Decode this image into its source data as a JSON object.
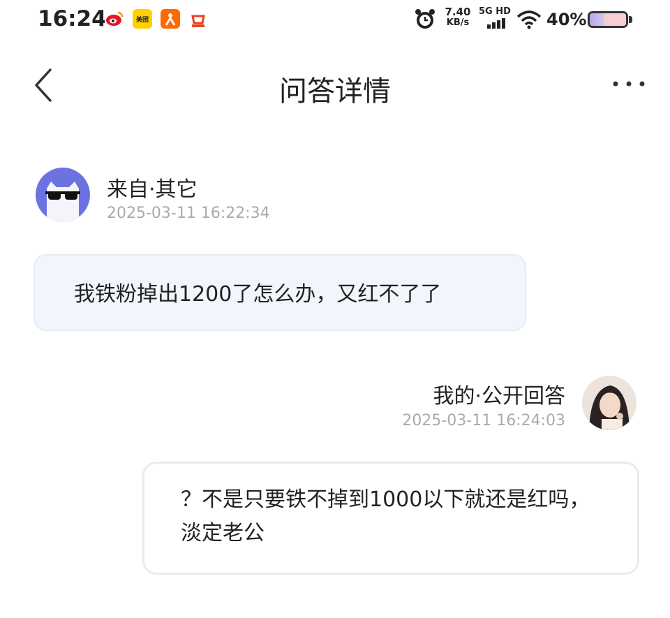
{
  "status_bar": {
    "time": "16:24",
    "app_icons": [
      "weibo-icon",
      "meituan-icon",
      "taobao-icon",
      "ele-icon"
    ],
    "net_speed": "7.40",
    "net_unit": "KB/s",
    "network": "5G HD",
    "battery_percent": "40%",
    "battery_level": 0.4
  },
  "nav": {
    "title": "问答详情"
  },
  "question": {
    "sender": "来自·其它",
    "timestamp": "2025-03-11 16:22:34",
    "text": "我铁粉掉出1200了怎么办，又红不了了"
  },
  "answer": {
    "sender": "我的·公开回答",
    "timestamp": "2025-03-11 16:24:03",
    "text": "？不是只要铁不掉到1000以下就还是红吗，淡定老公"
  },
  "colors": {
    "question_bubble_bg": "#f1f6fc",
    "avatar_bg": "#6c73e0",
    "timestamp_color": "#aaaaaa"
  }
}
